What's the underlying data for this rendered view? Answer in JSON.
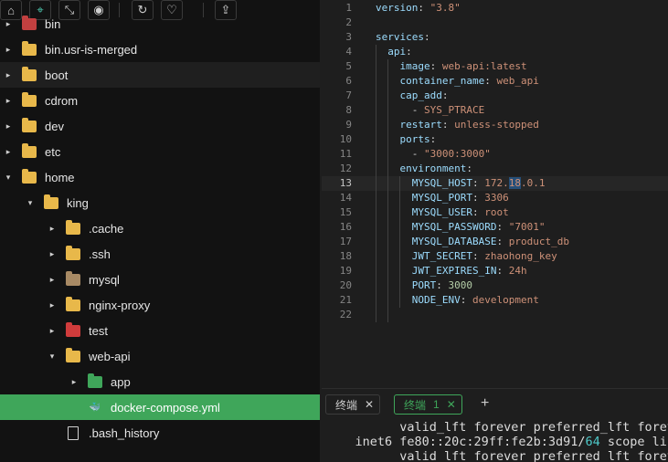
{
  "toolbar": {
    "icons": [
      "home-icon",
      "locate-icon",
      "collapse-icon",
      "eye-icon",
      "refresh-icon",
      "heart-icon",
      "upload-icon"
    ],
    "glyphs": [
      "⌂",
      "⌖",
      "⤡",
      "◉",
      "↻",
      "♡",
      "⇪"
    ]
  },
  "tree": [
    {
      "label": "bin",
      "arrow": "▸",
      "icon": "folder-icon",
      "color": "#c24040"
    },
    {
      "label": "bin.usr-is-merged",
      "arrow": "▸",
      "icon": "folder-icon",
      "color": "#e8b84a"
    },
    {
      "label": "boot",
      "arrow": "▸",
      "icon": "folder-icon",
      "color": "#e8b84a"
    },
    {
      "label": "cdrom",
      "arrow": "▸",
      "icon": "folder-icon",
      "color": "#e8b84a"
    },
    {
      "label": "dev",
      "arrow": "▸",
      "icon": "folder-icon",
      "color": "#e8b84a"
    },
    {
      "label": "etc",
      "arrow": "▸",
      "icon": "folder-icon",
      "color": "#e8b84a"
    },
    {
      "label": "home",
      "arrow": "▾",
      "icon": "folder-icon",
      "color": "#e8b84a"
    },
    {
      "label": "king",
      "arrow": "▾",
      "icon": "folder-icon",
      "color": "#e8b84a"
    },
    {
      "label": ".cache",
      "arrow": "▸",
      "icon": "folder-icon",
      "color": "#e8b84a"
    },
    {
      "label": ".ssh",
      "arrow": "▸",
      "icon": "folder-icon",
      "color": "#e8b84a"
    },
    {
      "label": "mysql",
      "arrow": "▸",
      "icon": "database-folder-icon",
      "color": "#a88a64"
    },
    {
      "label": "nginx-proxy",
      "arrow": "▸",
      "icon": "folder-icon",
      "color": "#e8b84a"
    },
    {
      "label": "test",
      "arrow": "▸",
      "icon": "test-folder-icon",
      "color": "#d03c3c"
    },
    {
      "label": "web-api",
      "arrow": "▾",
      "icon": "folder-icon",
      "color": "#e8b84a"
    },
    {
      "label": "app",
      "arrow": "▸",
      "icon": "app-folder-icon",
      "color": "#3fa65a"
    },
    {
      "label": "docker-compose.yml",
      "arrow": "",
      "icon": "docker-icon",
      "color": "#4a9fd8"
    },
    {
      "label": ".bash_history",
      "arrow": "",
      "icon": "file-icon",
      "color": "#d0d0d0"
    }
  ],
  "editor": {
    "current_line": 13,
    "lines": [
      {
        "n": "1",
        "segs": [
          [
            "k",
            "version"
          ],
          [
            "p",
            ": "
          ],
          [
            "s",
            "\"3.8\""
          ]
        ]
      },
      {
        "n": "2",
        "segs": []
      },
      {
        "n": "3",
        "segs": [
          [
            "k",
            "services"
          ],
          [
            "p",
            ":"
          ]
        ]
      },
      {
        "n": "4",
        "segs": [
          [
            "p",
            "  "
          ],
          [
            "k",
            "api"
          ],
          [
            "p",
            ":"
          ]
        ]
      },
      {
        "n": "5",
        "segs": [
          [
            "p",
            "    "
          ],
          [
            "k",
            "image"
          ],
          [
            "p",
            ": "
          ],
          [
            "s",
            "web-api:latest"
          ]
        ]
      },
      {
        "n": "6",
        "segs": [
          [
            "p",
            "    "
          ],
          [
            "k",
            "container_name"
          ],
          [
            "p",
            ": "
          ],
          [
            "s",
            "web_api"
          ]
        ]
      },
      {
        "n": "7",
        "segs": [
          [
            "p",
            "    "
          ],
          [
            "k",
            "cap_add"
          ],
          [
            "p",
            ":"
          ]
        ]
      },
      {
        "n": "8",
        "segs": [
          [
            "p",
            "      - "
          ],
          [
            "s",
            "SYS_PTRACE"
          ]
        ]
      },
      {
        "n": "9",
        "segs": [
          [
            "p",
            "    "
          ],
          [
            "k",
            "restart"
          ],
          [
            "p",
            ": "
          ],
          [
            "s",
            "unless-stopped"
          ]
        ]
      },
      {
        "n": "10",
        "segs": [
          [
            "p",
            "    "
          ],
          [
            "k",
            "ports"
          ],
          [
            "p",
            ":"
          ]
        ]
      },
      {
        "n": "11",
        "segs": [
          [
            "p",
            "      - "
          ],
          [
            "s",
            "\"3000:3000\""
          ]
        ]
      },
      {
        "n": "12",
        "segs": [
          [
            "p",
            "    "
          ],
          [
            "k",
            "environment"
          ],
          [
            "p",
            ":"
          ]
        ]
      },
      {
        "n": "13",
        "segs": [
          [
            "p",
            "      "
          ],
          [
            "k",
            "MYSQL_HOST"
          ],
          [
            "p",
            ": "
          ],
          [
            "s",
            "172."
          ],
          [
            "sel",
            "18"
          ],
          [
            "s",
            ".0.1"
          ]
        ]
      },
      {
        "n": "14",
        "segs": [
          [
            "p",
            "      "
          ],
          [
            "k",
            "MYSQL_PORT"
          ],
          [
            "p",
            ": "
          ],
          [
            "s",
            "3306"
          ]
        ]
      },
      {
        "n": "15",
        "segs": [
          [
            "p",
            "      "
          ],
          [
            "k",
            "MYSQL_USER"
          ],
          [
            "p",
            ": "
          ],
          [
            "s",
            "root"
          ]
        ]
      },
      {
        "n": "16",
        "segs": [
          [
            "p",
            "      "
          ],
          [
            "k",
            "MYSQL_PASSWORD"
          ],
          [
            "p",
            ": "
          ],
          [
            "s",
            "\"7001\""
          ]
        ]
      },
      {
        "n": "17",
        "segs": [
          [
            "p",
            "      "
          ],
          [
            "k",
            "MYSQL_DATABASE"
          ],
          [
            "p",
            ": "
          ],
          [
            "s",
            "product_db"
          ]
        ]
      },
      {
        "n": "18",
        "segs": [
          [
            "p",
            "      "
          ],
          [
            "k",
            "JWT_SECRET"
          ],
          [
            "p",
            ": "
          ],
          [
            "s",
            "zhaohong_key"
          ]
        ]
      },
      {
        "n": "19",
        "segs": [
          [
            "p",
            "      "
          ],
          [
            "k",
            "JWT_EXPIRES_IN"
          ],
          [
            "p",
            ": "
          ],
          [
            "s",
            "24h"
          ]
        ]
      },
      {
        "n": "20",
        "segs": [
          [
            "p",
            "      "
          ],
          [
            "k",
            "PORT"
          ],
          [
            "p",
            ": "
          ],
          [
            "n",
            "3000"
          ]
        ]
      },
      {
        "n": "21",
        "segs": [
          [
            "p",
            "      "
          ],
          [
            "k",
            "NODE_ENV"
          ],
          [
            "p",
            ": "
          ],
          [
            "s",
            "development"
          ]
        ]
      },
      {
        "n": "22",
        "segs": []
      }
    ]
  },
  "terminal": {
    "tabs": [
      {
        "label": "终端",
        "num": "",
        "active": false
      },
      {
        "label": "终端",
        "num": "1",
        "active": true
      }
    ],
    "close_glyph": "✕",
    "add_glyph": "+",
    "lines": [
      {
        "indent": "          ",
        "segs": [
          [
            "p",
            "valid_lft forever preferred_lft forever"
          ]
        ]
      },
      {
        "indent": "    ",
        "segs": [
          [
            "p",
            "inet6 fe80::20c:29ff:fe2b:3d91/"
          ],
          [
            "cyan",
            "64"
          ],
          [
            "p",
            " scope link"
          ]
        ]
      },
      {
        "indent": "          ",
        "segs": [
          [
            "p",
            "valid_lft forever preferred_lft forever"
          ]
        ]
      }
    ]
  }
}
